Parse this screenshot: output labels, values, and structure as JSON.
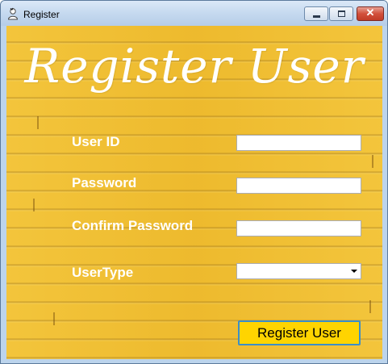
{
  "window": {
    "title": "Register",
    "icon": "user-icon",
    "controls": {
      "minimize": "minimize-icon",
      "maximize": "maximize-icon",
      "close": "✕"
    }
  },
  "form": {
    "heading": "Register User",
    "fields": {
      "user_id": {
        "label": "User ID",
        "value": ""
      },
      "password": {
        "label": "Password",
        "value": ""
      },
      "confirm_password": {
        "label": "Confirm Password",
        "value": ""
      },
      "user_type": {
        "label": "UserType",
        "selected": ""
      }
    },
    "submit_label": "Register User"
  },
  "colors": {
    "background": "#f1bf31",
    "label_text": "#ffffff",
    "button_fill": "#ffd400",
    "button_border": "#3b8ec9"
  }
}
